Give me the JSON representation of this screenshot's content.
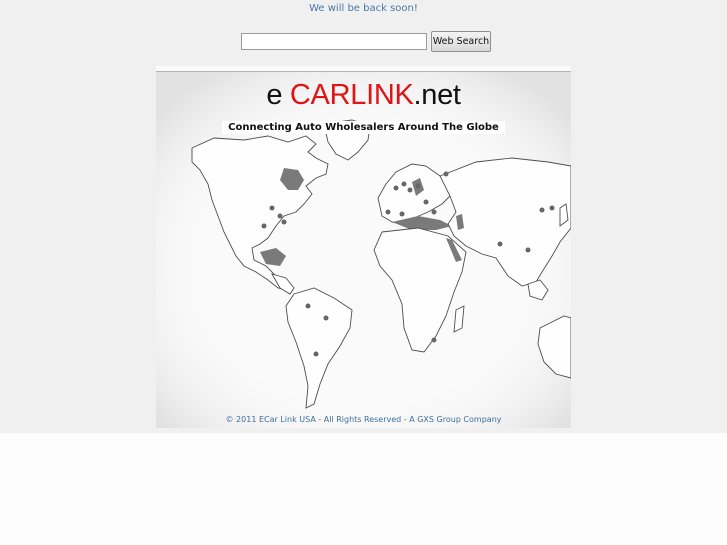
{
  "notice": "We will be back soon!",
  "search": {
    "placeholder": "",
    "value": "",
    "button_label": "Web Search"
  },
  "logo": {
    "prefix": "e ",
    "brand": "CARLINK",
    "suffix": ".net",
    "brand_color": "#e01414"
  },
  "tagline": "Connecting Auto Wholesalers Around The Globe",
  "copyright": "© 2011 ECar Link USA - All Rights Reserved - A GXS Group Company",
  "colors": {
    "notice_text": "#4a78a8",
    "background_band": "#f0f0f0",
    "land": "#fefefe",
    "coast": "#4d4d4d",
    "marker": "#666666"
  }
}
